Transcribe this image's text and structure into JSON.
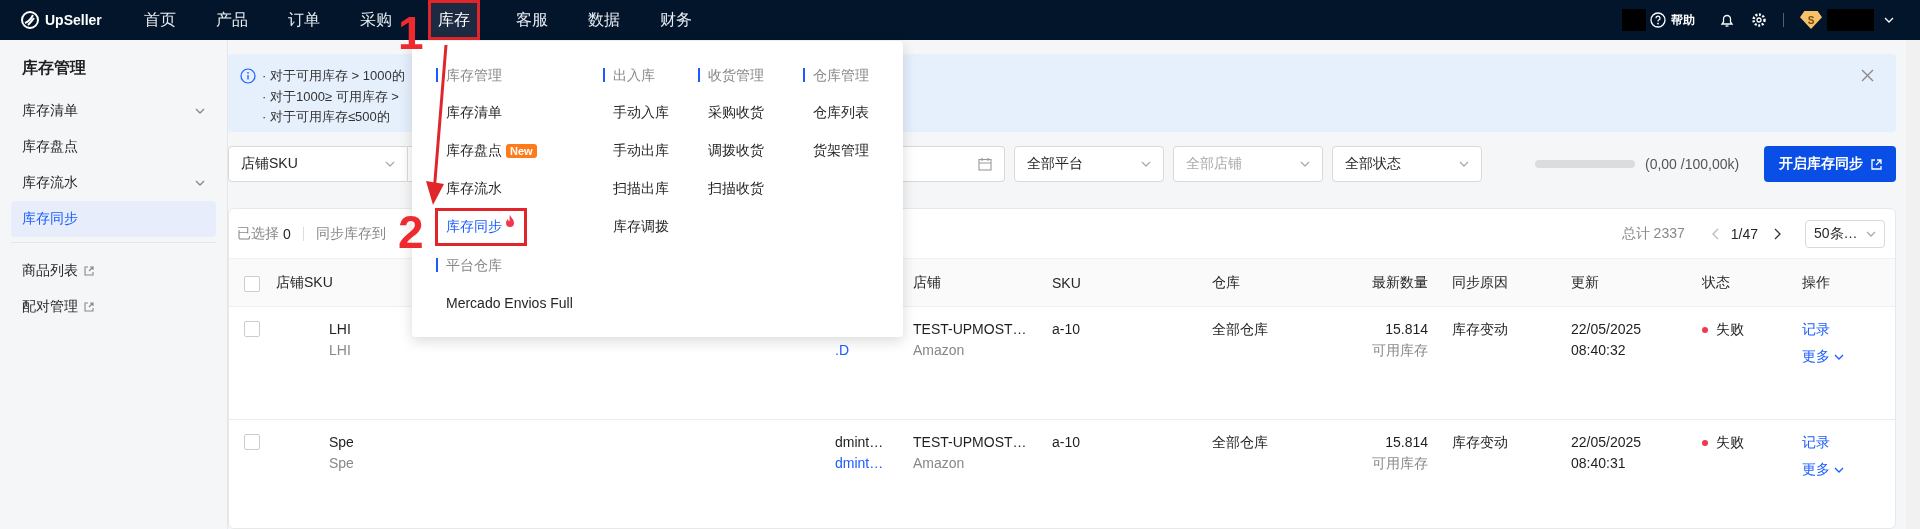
{
  "topbar": {
    "logo": "UpSeller",
    "nav": [
      {
        "label": "首页",
        "selected": false,
        "highlighted": false
      },
      {
        "label": "产品",
        "selected": false,
        "highlighted": false
      },
      {
        "label": "订单",
        "selected": false,
        "highlighted": false
      },
      {
        "label": "采购",
        "selected": false,
        "highlighted": false
      },
      {
        "label": "库存",
        "selected": true,
        "highlighted": true
      },
      {
        "label": "客服",
        "selected": false,
        "highlighted": false
      },
      {
        "label": "数据",
        "selected": false,
        "highlighted": false
      },
      {
        "label": "财务",
        "selected": false,
        "highlighted": false
      }
    ],
    "help": "帮助",
    "avatar_letter": "S"
  },
  "sidebar": {
    "title": "库存管理",
    "groups": [
      [
        {
          "label": "库存清单",
          "kind": "expandable",
          "selected": false
        },
        {
          "label": "库存盘点",
          "kind": "plain",
          "selected": false
        },
        {
          "label": "库存流水",
          "kind": "expandable",
          "selected": false
        },
        {
          "label": "库存同步",
          "kind": "plain",
          "selected": true
        }
      ],
      [
        {
          "label": "商品列表",
          "kind": "external",
          "selected": false
        },
        {
          "label": "配对管理",
          "kind": "external",
          "selected": false
        }
      ]
    ]
  },
  "notice": {
    "lines": [
      "· 对于可用库存 > 1000的",
      "· 对于1000≥ 可用库存 >",
      "· 对于可用库存≤500的"
    ]
  },
  "filters": {
    "sku_select": "店铺SKU",
    "platform": "全部平台",
    "store_placeholder": "全部店铺",
    "status": "全部状态",
    "quota": {
      "level": 0,
      "reading": "(0,00 /100,00k)"
    },
    "sync_button": "开启库存同步"
  },
  "table": {
    "all_checked": false,
    "selected_label": "已选择",
    "selected_count": "0",
    "bulk_action": "同步库存到",
    "total_label": "总计 2337",
    "page": "1/47",
    "page_size": "50条…",
    "columns": [
      "店铺SKU",
      "店铺",
      "SKU",
      "仓库",
      "最新数量",
      "同步原因",
      "更新",
      "状态",
      "操作"
    ],
    "rows": [
      {
        "checked": false,
        "sku": "LHI",
        "sku_sub": "LHI",
        "listing_link": ".D",
        "store": "TEST-UPMOST…",
        "platform": "Amazon",
        "sku_code": "a-10",
        "warehouse": "全部仓库",
        "quantity": "15.814",
        "quantity_note": "可用库存",
        "reason": "库存变动",
        "date": "22/05/2025",
        "time": "08:40:32",
        "status": {
          "text": "失败",
          "color": "#f0384f"
        },
        "record": "记录",
        "more": "更多"
      },
      {
        "checked": false,
        "sku": "Spe",
        "sku_sub": "Spe",
        "listing": "dmint…",
        "listing_link": "dmint…",
        "store": "TEST-UPMOST…",
        "platform": "Amazon",
        "sku_code": "a-10",
        "warehouse": "全部仓库",
        "quantity": "15.814",
        "quantity_note": "可用库存",
        "reason": "库存变动",
        "date": "22/05/2025",
        "time": "08:40:31",
        "status": {
          "text": "失败",
          "color": "#f0384f"
        },
        "record": "记录",
        "more": "更多"
      }
    ]
  },
  "dropdown": {
    "columns": [
      {
        "sections": [
          {
            "title": "库存管理",
            "items": [
              {
                "label": "库存清单",
                "selected": false,
                "highlighted": false,
                "hot": false
              },
              {
                "label": "库存盘点",
                "badge": "New",
                "selected": false,
                "highlighted": false,
                "hot": false
              },
              {
                "label": "库存流水",
                "selected": false,
                "highlighted": false,
                "hot": false
              },
              {
                "label": "库存同步",
                "selected": true,
                "highlighted": true,
                "hot": true
              }
            ]
          },
          {
            "title": "平台仓库",
            "items": [
              {
                "label": "Mercado Envios Full",
                "selected": false,
                "highlighted": false,
                "hot": false
              }
            ]
          }
        ]
      },
      {
        "sections": [
          {
            "title": "出入库",
            "items": [
              {
                "label": "手动入库",
                "selected": false,
                "highlighted": false,
                "hot": false
              },
              {
                "label": "手动出库",
                "selected": false,
                "highlighted": false,
                "hot": false
              },
              {
                "label": "扫描出库",
                "selected": false,
                "highlighted": false,
                "hot": false
              },
              {
                "label": "库存调拨",
                "selected": false,
                "highlighted": false,
                "hot": false
              }
            ]
          }
        ]
      },
      {
        "sections": [
          {
            "title": "收货管理",
            "items": [
              {
                "label": "采购收货",
                "selected": false,
                "highlighted": false,
                "hot": false
              },
              {
                "label": "调拨收货",
                "selected": false,
                "highlighted": false,
                "hot": false
              },
              {
                "label": "扫描收货",
                "selected": false,
                "highlighted": false,
                "hot": false
              }
            ]
          }
        ]
      },
      {
        "sections": [
          {
            "title": "仓库管理",
            "items": [
              {
                "label": "仓库列表",
                "selected": false,
                "highlighted": false,
                "hot": false
              },
              {
                "label": "货架管理",
                "selected": false,
                "highlighted": false,
                "hot": false
              }
            ]
          }
        ]
      }
    ]
  },
  "annotations": [
    {
      "text": "1"
    },
    {
      "text": "2"
    }
  ]
}
